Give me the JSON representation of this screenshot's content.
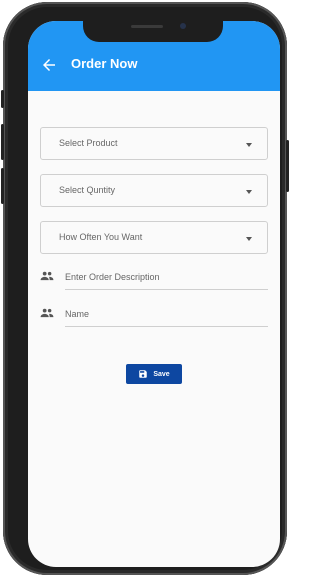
{
  "header": {
    "title": "Order Now",
    "back_icon": "arrow-left-icon",
    "color": "#2196f3"
  },
  "form": {
    "product_select": {
      "label": "Select Product"
    },
    "quantity_select": {
      "label": "Select Quntity"
    },
    "frequency_select": {
      "label": "How Often You Want"
    },
    "description_field": {
      "placeholder": "Enter Order Description",
      "icon": "people-icon"
    },
    "name_field": {
      "placeholder": "Name",
      "icon": "people-icon"
    }
  },
  "save_button": {
    "label": "Save",
    "icon": "floppy-disk-icon",
    "color": "#0d47a1"
  }
}
